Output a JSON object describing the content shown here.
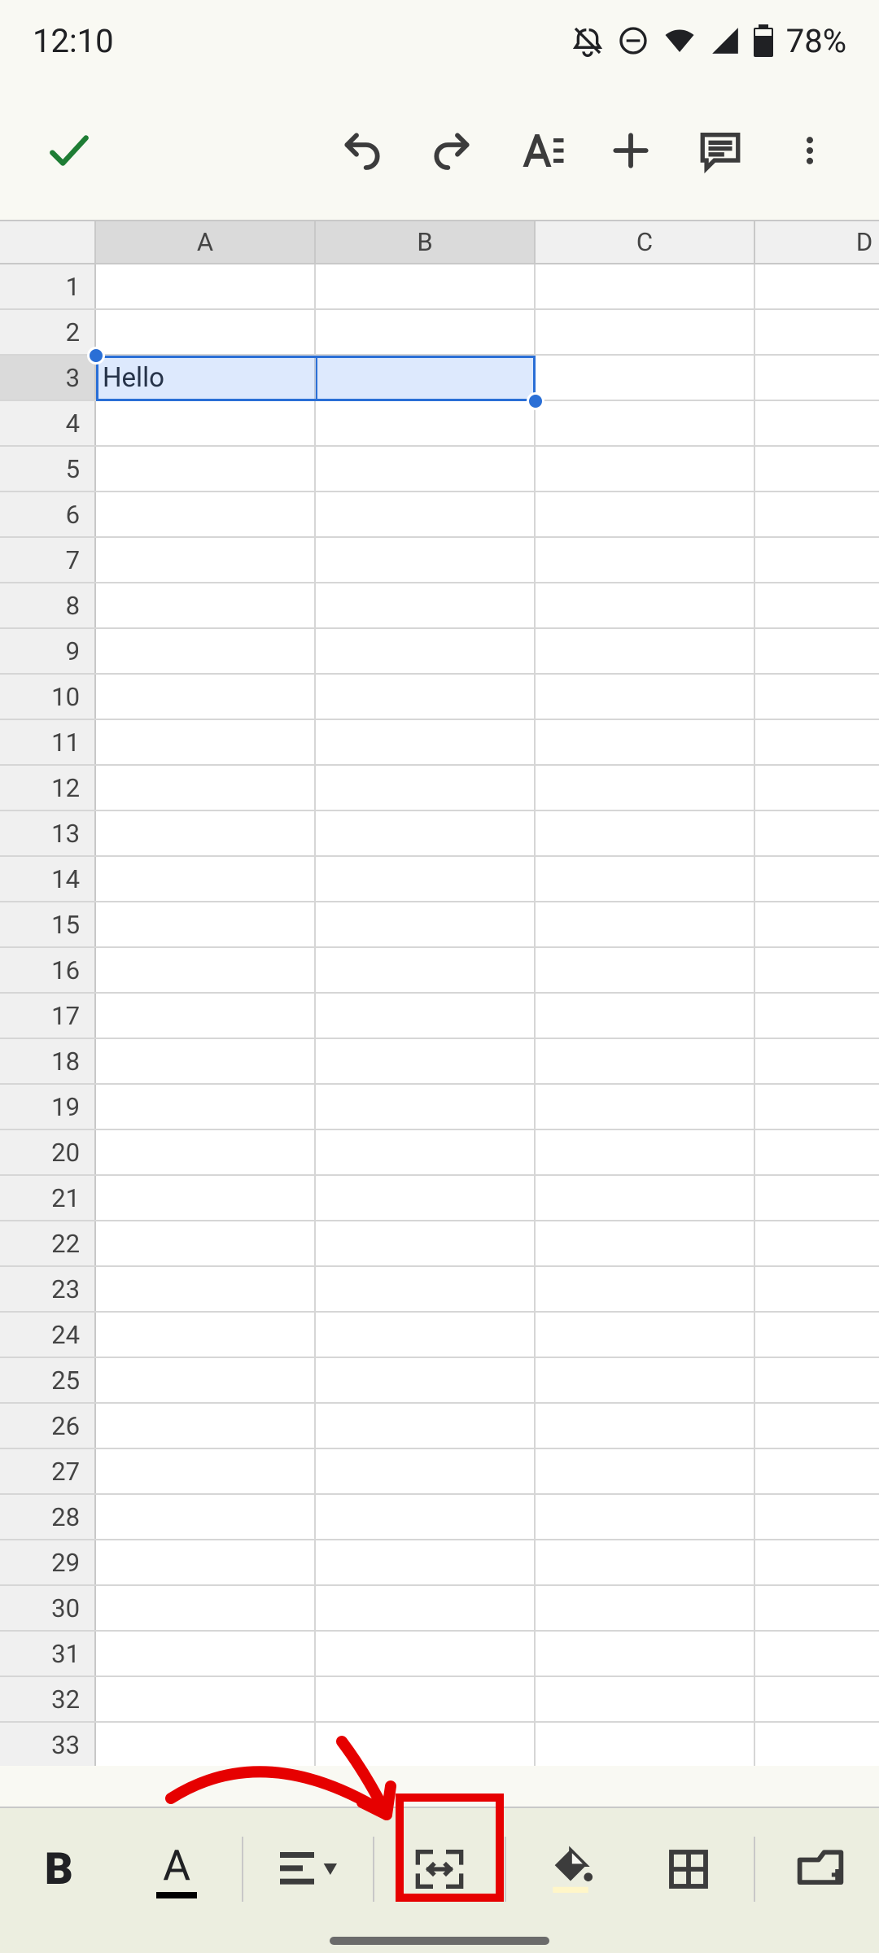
{
  "status": {
    "time": "12:10",
    "battery": "78%"
  },
  "columns": [
    "A",
    "B",
    "C",
    "D"
  ],
  "rows_visible": 33,
  "selected_row": 3,
  "selected_cols": [
    "A",
    "B"
  ],
  "cells": {
    "A3": "Hello"
  },
  "format_bar": {
    "bold": "B",
    "textcolor": "A"
  }
}
